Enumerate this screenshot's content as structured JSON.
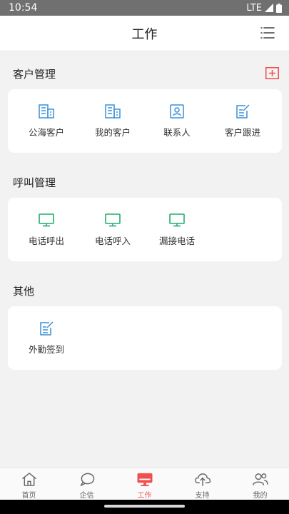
{
  "status": {
    "time": "10:54",
    "network": "LTE"
  },
  "header": {
    "title": "工作"
  },
  "sections": {
    "customer": {
      "title": "客户管理",
      "items": [
        {
          "label": "公海客户",
          "icon": "building-icon"
        },
        {
          "label": "我的客户",
          "icon": "building-icon"
        },
        {
          "label": "联系人",
          "icon": "contact-card-icon"
        },
        {
          "label": "客户跟进",
          "icon": "edit-note-icon"
        }
      ]
    },
    "call": {
      "title": "呼叫管理",
      "items": [
        {
          "label": "电话呼出",
          "icon": "monitor-icon"
        },
        {
          "label": "电话呼入",
          "icon": "monitor-icon"
        },
        {
          "label": "漏接电话",
          "icon": "monitor-icon"
        }
      ]
    },
    "other": {
      "title": "其他",
      "items": [
        {
          "label": "外勤签到",
          "icon": "edit-note-icon"
        }
      ]
    }
  },
  "tabs": [
    {
      "label": "首页",
      "icon": "home-icon"
    },
    {
      "label": "企信",
      "icon": "chat-bubble-icon"
    },
    {
      "label": "工作",
      "icon": "work-monitor-icon",
      "active": true
    },
    {
      "label": "支持",
      "icon": "cloud-upload-icon"
    },
    {
      "label": "我的",
      "icon": "users-icon"
    }
  ],
  "colors": {
    "accent": "#f0504d",
    "blue_icon": "#3a8fd6",
    "green_icon": "#1fae6e"
  }
}
